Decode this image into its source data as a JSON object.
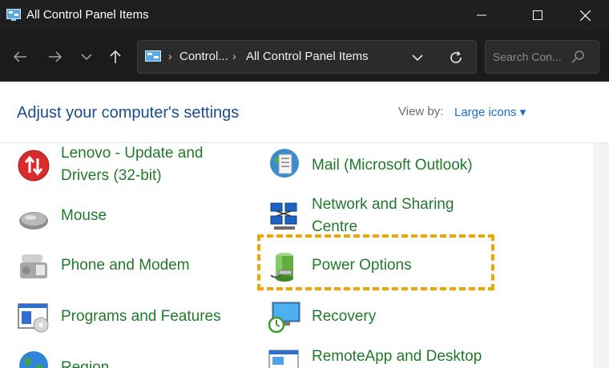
{
  "window": {
    "title": "All Control Panel Items"
  },
  "address": {
    "crumbs": [
      "Control...",
      "All Control Panel Items"
    ],
    "separator": "›"
  },
  "search": {
    "placeholder": "Search Con..."
  },
  "header": {
    "heading": "Adjust your computer's settings",
    "view_by_label": "View by:",
    "view_by_value": "Large icons ▾"
  },
  "items": {
    "lenovo": {
      "line1": "Lenovo - Update and",
      "line2": "Drivers (32-bit)"
    },
    "mouse": "Mouse",
    "phone": "Phone and Modem",
    "programs": "Programs and Features",
    "region": "Region",
    "mail": "Mail (Microsoft Outlook)",
    "network": {
      "line1": "Network and Sharing",
      "line2": "Centre"
    },
    "power": "Power Options",
    "recovery": "Recovery",
    "remoteapp": "RemoteApp and Desktop"
  },
  "colors": {
    "link_green": "#1f7a2a",
    "highlight": "#f0a500",
    "title_bar": "#1f1f1f"
  }
}
